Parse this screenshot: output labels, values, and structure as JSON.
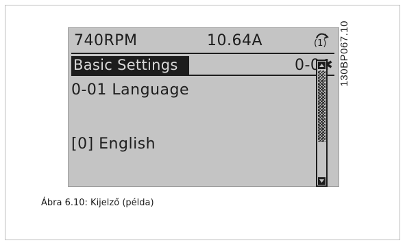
{
  "status_bar": {
    "speed": "740RPM",
    "current": "10.64A",
    "setup_indicator": "(1)",
    "icon": "setup-cycle-icon"
  },
  "menu": {
    "title": "Basic Settings",
    "param_group": "0-0✱"
  },
  "parameter": {
    "name": "0-01 Language",
    "value": "[0] English"
  },
  "figure": {
    "code": "130BP067.10",
    "caption": "Ábra 6.10: Kijelző (példa)"
  },
  "colors": {
    "lcd_background": "#c4c4c4",
    "lcd_ink": "#1d1d1d"
  }
}
